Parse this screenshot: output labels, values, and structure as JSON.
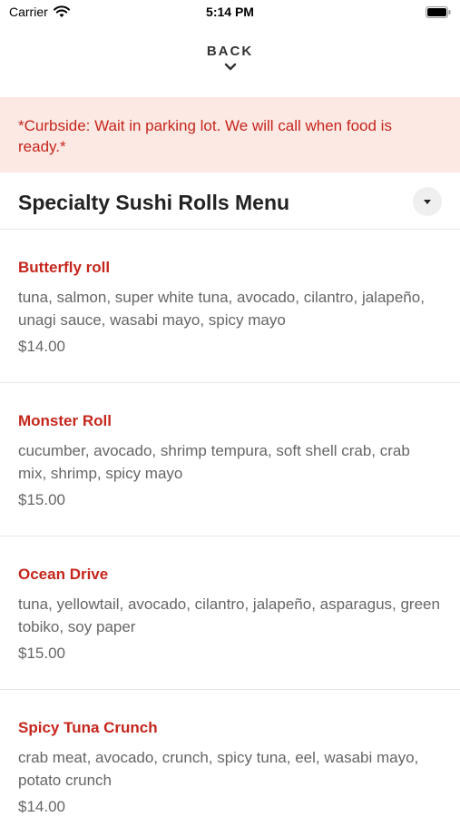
{
  "status_bar": {
    "carrier": "Carrier",
    "time": "5:14 PM",
    "wifi_icon": "wifi-icon",
    "battery_icon": "battery-icon"
  },
  "nav": {
    "back_label": "BACK",
    "back_icon": "chevron-down-icon"
  },
  "notice": {
    "text": "*Curbside: Wait in parking lot. We will call when food is ready.*",
    "background": "#fde9e4",
    "color": "#c4261d"
  },
  "menu": {
    "title": "Specialty Sushi Rolls Menu",
    "dropdown_icon": "caret-down-icon",
    "items": [
      {
        "name": "Butterfly roll",
        "description": "tuna, salmon, super white tuna, avocado, cilantro, jalapeño, unagi sauce, wasabi mayo, spicy mayo",
        "price": "$14.00"
      },
      {
        "name": "Monster Roll",
        "description": "cucumber, avocado, shrimp tempura, soft shell crab, crab mix, shrimp, spicy mayo",
        "price": "$15.00"
      },
      {
        "name": "Ocean Drive",
        "description": "tuna, yellowtail, avocado, cilantro, jalapeño, asparagus, green tobiko, soy paper",
        "price": "$15.00"
      },
      {
        "name": "Spicy Tuna Crunch",
        "description": "crab meat, avocado, crunch, spicy tuna, eel, wasabi mayo, potato crunch",
        "price": "$14.00"
      }
    ]
  },
  "colors": {
    "accent_red": "#c4261d",
    "text_gray": "#666666",
    "title_dark": "#222222"
  }
}
